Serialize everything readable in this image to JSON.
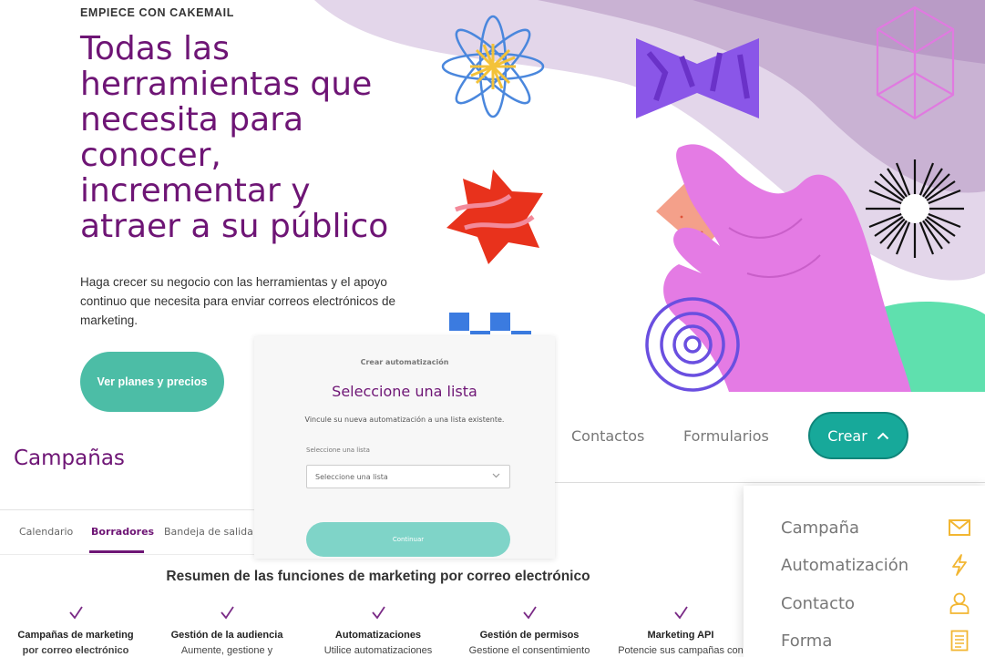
{
  "hero": {
    "eyebrow": "EMPIECE CON CAKEMAIL",
    "title": "Todas las herramientas que necesita para conocer, incrementar y atraer a su público",
    "subtitle": "Haga crecer su negocio con las herramientas y el apoyo continuo que necesita para enviar correos electrónicos de marketing.",
    "cta_label": "Ver planes y precios"
  },
  "campaigns": {
    "title": "Campañas",
    "tabs": [
      {
        "label": "Calendario",
        "active": false
      },
      {
        "label": "Borradores",
        "active": true
      },
      {
        "label": "Bandeja de salida",
        "active": false
      }
    ]
  },
  "nav": {
    "items": [
      "Contactos",
      "Formularios"
    ],
    "create_label": "Crear"
  },
  "create_menu": {
    "items": [
      {
        "label": "Campaña",
        "icon": "envelope-icon"
      },
      {
        "label": "Automatización",
        "icon": "lightning-icon"
      },
      {
        "label": "Contacto",
        "icon": "person-icon"
      },
      {
        "label": "Forma",
        "icon": "document-icon"
      }
    ]
  },
  "modal": {
    "eyebrow": "Crear automatización",
    "title": "Seleccione una lista",
    "description": "Vincule su nueva automatización a una lista existente.",
    "field_label": "Seleccione una lista",
    "select_value": "Seleccione una lista",
    "continue_label": "Continuar"
  },
  "features": {
    "title": "Resumen de las funciones de marketing por correo electrónico",
    "items": [
      {
        "title": "Campañas de marketing",
        "desc": "por correo electrónico",
        "desc_bold": true
      },
      {
        "title": "Gestión de la audiencia",
        "desc": "Aumente, gestione y",
        "desc_bold": false
      },
      {
        "title": "Automatizaciones",
        "desc": "Utilice automatizaciones",
        "desc_bold": false
      },
      {
        "title": "Gestión de permisos",
        "desc": "Gestione el consentimiento",
        "desc_bold": false
      },
      {
        "title": "Marketing API",
        "desc": "Potencie sus campañas con",
        "desc_bold": false
      }
    ]
  },
  "colors": {
    "brand_purple": "#6e1575",
    "teal": "#17a99a",
    "cta_teal": "#4cbda6",
    "icon_amber": "#f2b632"
  }
}
